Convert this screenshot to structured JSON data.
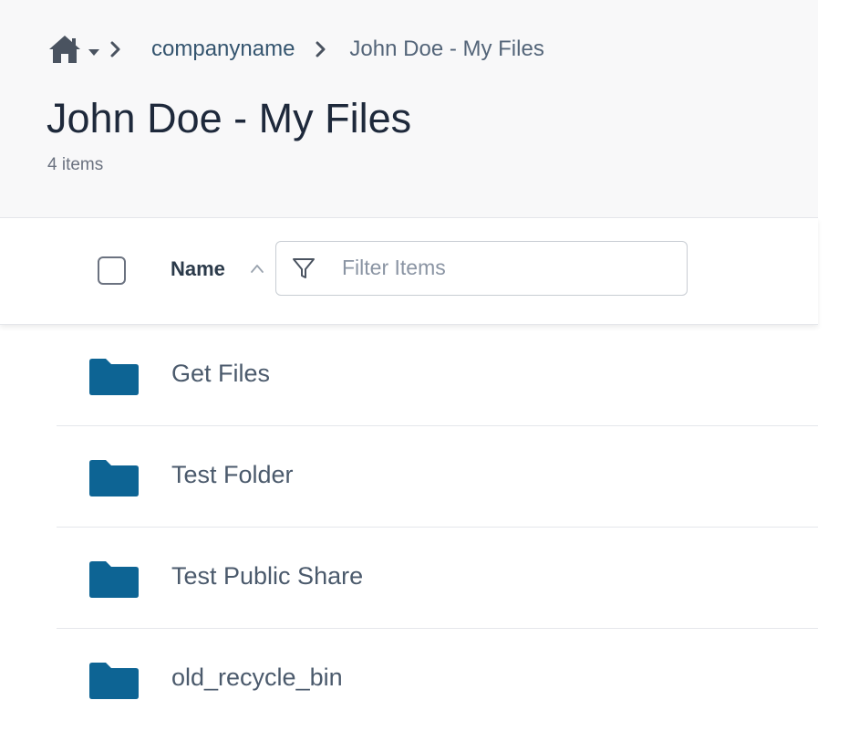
{
  "breadcrumb": {
    "home_icon": "home-icon",
    "items": [
      "companyname",
      "John Doe - My Files"
    ]
  },
  "header": {
    "title": "John Doe - My Files",
    "item_count": "4 items"
  },
  "list_header": {
    "name_label": "Name",
    "sort_direction": "ascending",
    "filter_placeholder": "Filter Items",
    "filter_value": ""
  },
  "files": [
    {
      "name": "Get Files",
      "type": "folder"
    },
    {
      "name": "Test Folder",
      "type": "folder"
    },
    {
      "name": "Test Public Share",
      "type": "folder"
    },
    {
      "name": "old_recycle_bin",
      "type": "folder"
    }
  ],
  "colors": {
    "folder": "#0d6494",
    "link": "#35556f",
    "header_bg": "#f8f8f9"
  }
}
